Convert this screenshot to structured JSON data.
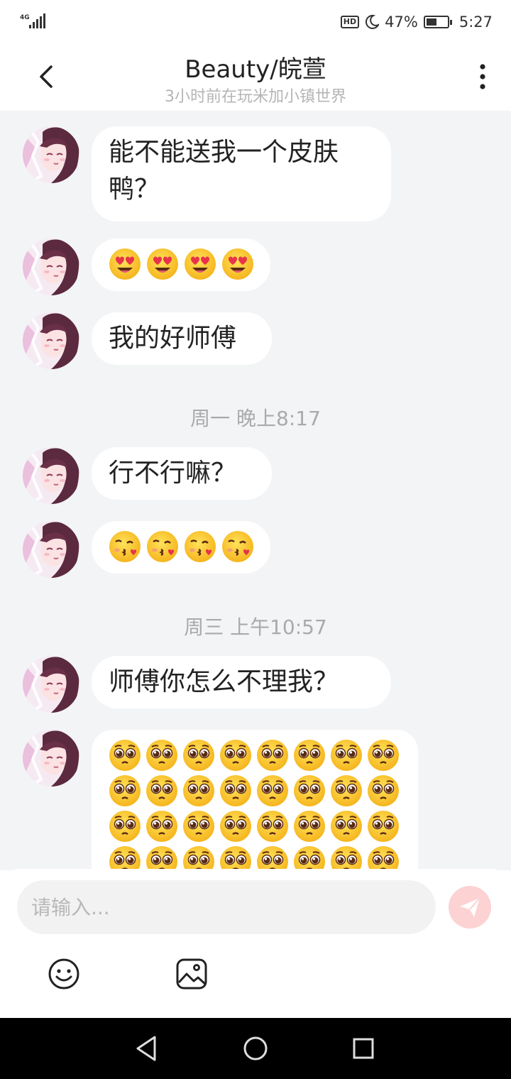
{
  "status_bar": {
    "network": "4G",
    "battery": "47%",
    "time": "5:27",
    "hd": "HD"
  },
  "header": {
    "title": "Beauty/皖萱",
    "subtitle": "3小时前在玩米加小镇世界"
  },
  "messages": [
    {
      "type": "text",
      "text_line1": "能不能送我一个皮肤",
      "text_line2": "鸭？"
    },
    {
      "type": "emoji",
      "emoji": "smiling-heart-eyes",
      "count": 4
    },
    {
      "type": "text",
      "text": "我的好师傅"
    },
    {
      "type": "timestamp",
      "text": "周一 晚上8:17"
    },
    {
      "type": "text",
      "text": "行不行嘛？"
    },
    {
      "type": "emoji",
      "emoji": "face-blowing-kiss",
      "count": 4
    },
    {
      "type": "timestamp",
      "text": "周三 上午10:57"
    },
    {
      "type": "text",
      "text": "师傅你怎么不理我？"
    },
    {
      "type": "emoji-grid",
      "emoji": "pleading-face",
      "columns": 8,
      "visible_rows": 4
    }
  ],
  "composer": {
    "placeholder": "请输入..."
  },
  "icons": {
    "back": "chevron-left-icon",
    "more": "more-vertical-icon",
    "send": "send-icon",
    "emoji": "emoji-icon",
    "image": "image-icon"
  },
  "colors": {
    "chat_bg": "#f3f4f6",
    "send_button": "#fcd2d2",
    "accent": "#f48a8a"
  }
}
